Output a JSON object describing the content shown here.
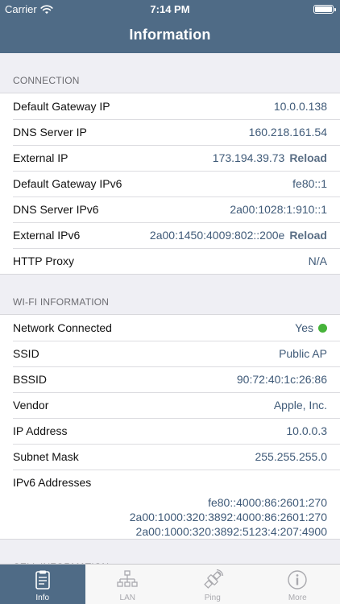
{
  "status_bar": {
    "carrier": "Carrier",
    "time": "7:14 PM"
  },
  "nav": {
    "title": "Information"
  },
  "sections": {
    "connection": {
      "header": "CONNECTION",
      "rows": [
        {
          "label": "Default Gateway IP",
          "value": "10.0.0.138"
        },
        {
          "label": "DNS Server IP",
          "value": "160.218.161.54"
        },
        {
          "label": "External IP",
          "value": "173.194.39.73",
          "action": "Reload"
        },
        {
          "label": "Default Gateway IPv6",
          "value": "fe80::1"
        },
        {
          "label": "DNS Server IPv6",
          "value": "2a00:1028:1:910::1"
        },
        {
          "label": "External IPv6",
          "value": "2a00:1450:4009:802::200e",
          "action": "Reload"
        },
        {
          "label": "HTTP Proxy",
          "value": "N/A"
        }
      ]
    },
    "wifi": {
      "header": "WI-FI INFORMATION",
      "rows": [
        {
          "label": "Network Connected",
          "value": "Yes"
        },
        {
          "label": "SSID",
          "value": "Public AP"
        },
        {
          "label": "BSSID",
          "value": "90:72:40:1c:26:86"
        },
        {
          "label": "Vendor",
          "value": "Apple, Inc."
        },
        {
          "label": "IP Address",
          "value": "10.0.0.3"
        },
        {
          "label": "Subnet Mask",
          "value": "255.255.255.0"
        }
      ],
      "ipv6": {
        "label": "IPv6 Addresses",
        "values": [
          "fe80::4000:86:2601:270",
          "2a00:1000:320:3892:4000:86:2601:270",
          "2a00:1000:320:3892:5123:4:207:4900"
        ]
      }
    },
    "cell": {
      "header": "CELL INFORMATION"
    }
  },
  "tabs": [
    {
      "label": "Info",
      "icon": "clipboard-icon",
      "active": true
    },
    {
      "label": "LAN",
      "icon": "network-tree-icon",
      "active": false
    },
    {
      "label": "Ping",
      "icon": "satellite-icon",
      "active": false
    },
    {
      "label": "More",
      "icon": "info-circle-icon",
      "active": false
    }
  ],
  "colors": {
    "bar": "#4f6b86",
    "value_text": "#3f5a78",
    "connected_dot": "#46b33a"
  }
}
